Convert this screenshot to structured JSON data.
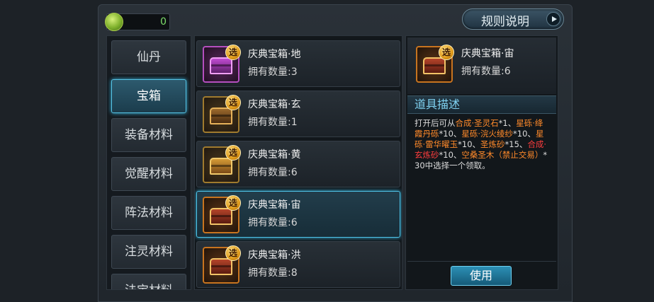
{
  "currency": {
    "icon": "jade-coin-icon",
    "value": "0"
  },
  "rules_button": {
    "label": "规则说明"
  },
  "categories": [
    {
      "label": "仙丹"
    },
    {
      "label": "宝箱"
    },
    {
      "label": "装备材料"
    },
    {
      "label": "觉醒材料"
    },
    {
      "label": "阵法材料"
    },
    {
      "label": "注灵材料"
    },
    {
      "label": "法宝材料"
    }
  ],
  "selected_category": "宝箱",
  "items": [
    {
      "name": "庆典宝箱·地",
      "count": "拥有数量:3",
      "badge": "选"
    },
    {
      "name": "庆典宝箱·玄",
      "count": "拥有数量:1",
      "badge": "选"
    },
    {
      "name": "庆典宝箱·黄",
      "count": "拥有数量:6",
      "badge": "选"
    },
    {
      "name": "庆典宝箱·宙",
      "count": "拥有数量:6",
      "badge": "选"
    },
    {
      "name": "庆典宝箱·洪",
      "count": "拥有数量:8",
      "badge": "选"
    }
  ],
  "detail": {
    "name": "庆典宝箱·宙",
    "count": "拥有数量:6",
    "badge": "选",
    "section_title": "道具描述",
    "desc": {
      "p1": "打开后可从",
      "p2": "合成·圣灵石",
      "p3": "*1、",
      "p4": "星砾·绛霞丹砾",
      "p5": "*10、",
      "p6": "星砾·浣火绫纱",
      "p7": "*10、",
      "p8": "星砾·雷华曜玉",
      "p9": "*10、",
      "p10": "圣炼砂",
      "p11": "*15、",
      "p12": "合成·玄炼砂",
      "p13": "*10、",
      "p14": "空桑圣木（禁止交易）",
      "p15": "*30中选择一个领取。"
    }
  },
  "use_button": {
    "label": "使用"
  }
}
